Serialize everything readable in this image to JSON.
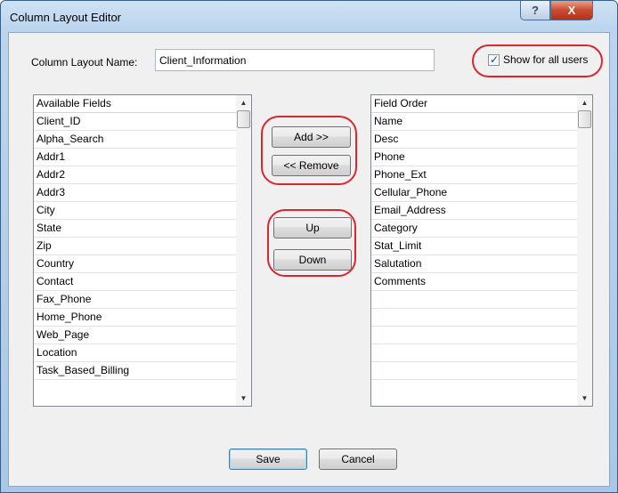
{
  "window": {
    "title": "Column Layout Editor",
    "help_glyph": "?",
    "close_glyph": "X"
  },
  "layout_name": {
    "label": "Column Layout Name:",
    "value": "Client_Information"
  },
  "show_all_users": {
    "label": "Show for all users",
    "checked": true,
    "check_glyph": "✓"
  },
  "available_list": {
    "header": "Available Fields",
    "items": [
      "Client_ID",
      "Alpha_Search",
      "Addr1",
      "Addr2",
      "Addr3",
      "City",
      "State",
      "Zip",
      "Country",
      "Contact",
      "Fax_Phone",
      "Home_Phone",
      "Web_Page",
      "Location",
      "Task_Based_Billing"
    ]
  },
  "order_list": {
    "header": "Field Order",
    "items": [
      "Name",
      "Desc",
      "Phone",
      "Phone_Ext",
      "Cellular_Phone",
      "Email_Address",
      "Category",
      "Stat_Limit",
      "Salutation",
      "Comments"
    ],
    "empty_rows": 5
  },
  "scroll_glyphs": {
    "up": "▲",
    "down": "▼"
  },
  "buttons": {
    "add": "Add >>",
    "remove": "<< Remove",
    "up": "Up",
    "down": "Down",
    "save": "Save",
    "cancel": "Cancel"
  },
  "colors": {
    "highlight": "#d9272e",
    "title_bar": "#bcd5ee",
    "close_button": "#c94b31"
  }
}
